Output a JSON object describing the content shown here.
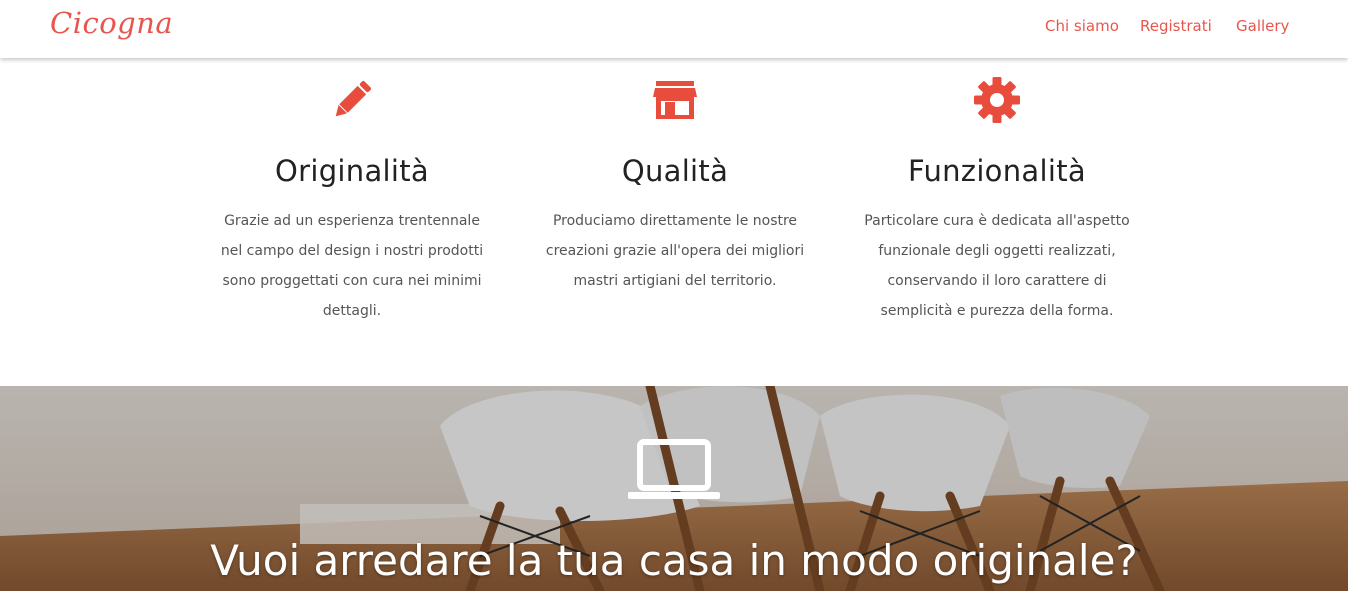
{
  "navbar": {
    "brand": "Cicogna",
    "links": [
      "Chi siamo",
      "Registrati",
      "Gallery"
    ]
  },
  "features": [
    {
      "icon": "pencil-icon",
      "title": "Originalità",
      "text": "Grazie ad un esperienza trentennale nel campo del design i nostri prodotti sono proggettati con cura nei minimi dettagli."
    },
    {
      "icon": "store-icon",
      "title": "Qualità",
      "text": "Produciamo direttamente le nostre creazioni grazie all'opera dei migliori mastri artigiani del territorio."
    },
    {
      "icon": "gear-icon",
      "title": "Funzionalità",
      "text": "Particolare cura è dedicata all'aspetto funzionale degli oggetti realizzati, conservando il loro carattere di semplicità e purezza della forma."
    }
  ],
  "hero": {
    "icon": "laptop-icon",
    "heading": "Vuoi arredare la tua casa in modo originale?"
  },
  "colors": {
    "accent": "#e8554e",
    "icon": "#e74c3c"
  }
}
